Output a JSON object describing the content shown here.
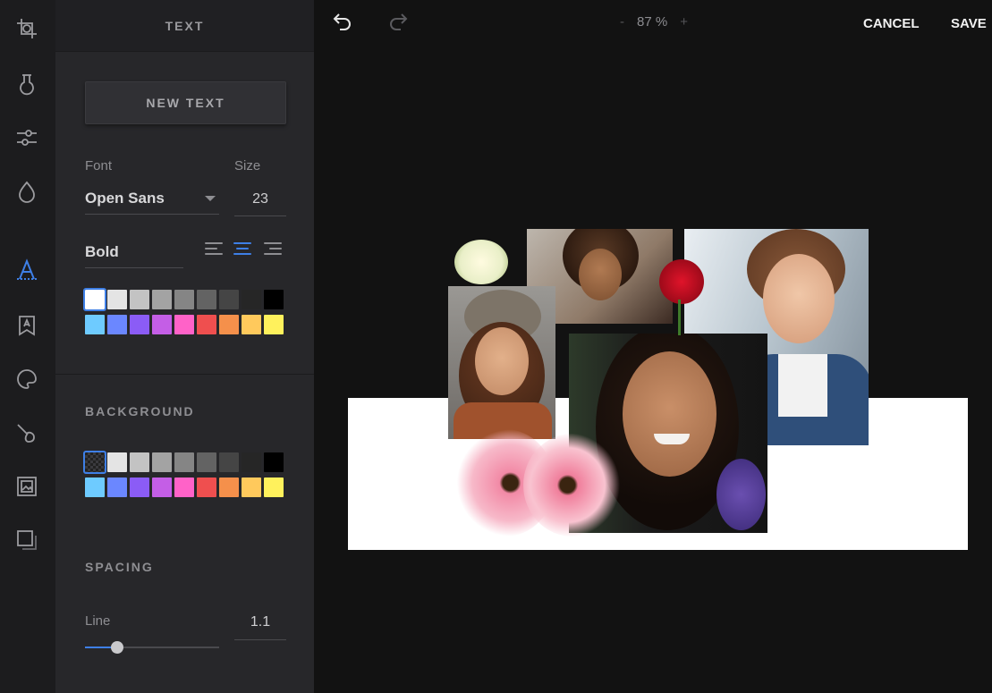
{
  "rail": {
    "tools": [
      {
        "icon": "crop-icon"
      },
      {
        "icon": "filter-flask-icon"
      },
      {
        "icon": "adjust-sliders-icon"
      },
      {
        "icon": "color-drop-icon"
      },
      {
        "icon": "text-icon"
      },
      {
        "icon": "sticker-icon"
      },
      {
        "icon": "overlay-icon"
      },
      {
        "icon": "brush-icon"
      },
      {
        "icon": "frame-icon"
      },
      {
        "icon": "shadow-icon"
      }
    ],
    "active_tool": "text-icon",
    "accent": "#3e7fe6"
  },
  "panel": {
    "title": "TEXT",
    "new_text_label": "NEW TEXT",
    "font_label": "Font",
    "font_value": "Open Sans",
    "size_label": "Size",
    "size_value": "23",
    "weight_value": "Bold",
    "alignment_selected": "center",
    "text_colors_row1": [
      "#ffffff",
      "#e4e4e4",
      "#c3c3c3",
      "#a3a3a3",
      "#858585",
      "#636363",
      "#454545",
      "#262626",
      "#000000"
    ],
    "text_colors_row2": [
      "#6ecbff",
      "#6b87ff",
      "#8b5cf6",
      "#c45ee6",
      "#ff62c8",
      "#ef4f4f",
      "#f5904b",
      "#ffc95c",
      "#fff15c"
    ],
    "text_selected_color": "#ffffff",
    "background_title": "BACKGROUND",
    "background_colors_row1": [
      "transparent",
      "#e4e4e4",
      "#c3c3c3",
      "#a3a3a3",
      "#858585",
      "#636363",
      "#454545",
      "#262626",
      "#000000"
    ],
    "background_colors_row2": [
      "#6ecbff",
      "#6b87ff",
      "#8b5cf6",
      "#c45ee6",
      "#ff62c8",
      "#ef4f4f",
      "#f5904b",
      "#ffc95c",
      "#fff15c"
    ],
    "background_selected": "transparent",
    "spacing_title": "SPACING",
    "line_label": "Line",
    "line_value": "1.1",
    "line_slider_fraction": 0.24
  },
  "topbar": {
    "undo_icon": "undo-icon",
    "redo_icon": "redo-icon",
    "zoom_minus": "-",
    "zoom_value": "87 %",
    "zoom_plus": "+",
    "cancel_label": "CANCEL",
    "save_label": "SAVE"
  }
}
